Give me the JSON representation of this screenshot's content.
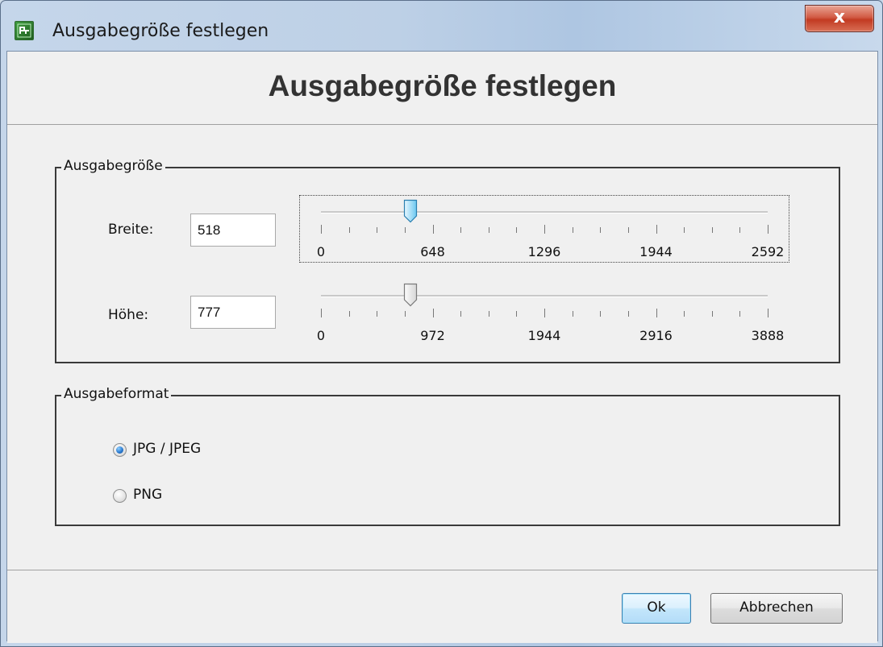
{
  "window": {
    "title": "Ausgabegröße festlegen",
    "close_glyph": "x"
  },
  "header": {
    "title": "Ausgabegröße festlegen"
  },
  "size_group": {
    "label": "Ausgabegröße",
    "width": {
      "label": "Breite:",
      "value": "518",
      "slider": {
        "min": 0,
        "max": 2592,
        "value": 518,
        "labels": [
          "0",
          "648",
          "1296",
          "1944",
          "2592"
        ]
      }
    },
    "height": {
      "label": "Höhe:",
      "value": "777",
      "slider": {
        "min": 0,
        "max": 3888,
        "value": 777,
        "labels": [
          "0",
          "972",
          "1944",
          "2916",
          "3888"
        ]
      }
    }
  },
  "format_group": {
    "label": "Ausgabeformat",
    "options": [
      {
        "label": "JPG / JPEG",
        "checked": true
      },
      {
        "label": "PNG",
        "checked": false
      }
    ]
  },
  "buttons": {
    "ok": "Ok",
    "cancel": "Abbrechen"
  },
  "colors": {
    "close_button": "#c23a22",
    "focus_thumb": "#4cb8e8",
    "header_text": "#333333"
  }
}
